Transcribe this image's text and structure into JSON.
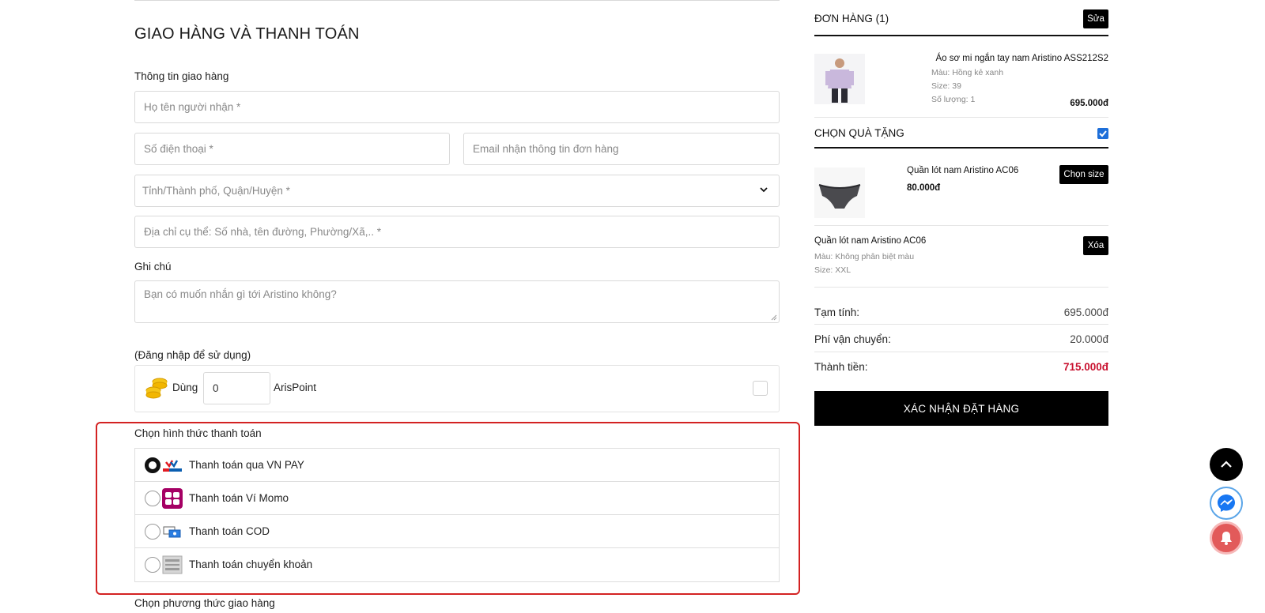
{
  "checkout": {
    "title": "GIAO HÀNG VÀ THANH TOÁN",
    "shipping_info_label": "Thông tin giao hàng",
    "fields": {
      "name_placeholder": "Họ tên người nhận *",
      "phone_placeholder": "Số điện thoại *",
      "email_placeholder": "Email nhận thông tin đơn hàng",
      "region_placeholder": "Tỉnh/Thành phố, Quận/Huyện *",
      "address_placeholder": "Địa chỉ cụ thể: Số nhà, tên đường, Phường/Xã,.. *"
    },
    "note_label": "Ghi chú",
    "note_placeholder": "Bạn có muốn nhắn gì tới Aristino không?",
    "login_hint": "(Đăng nhập để sử dụng)",
    "points": {
      "use_label": "Dùng",
      "value": "0",
      "unit": "ArisPoint"
    },
    "payment_label": "Chọn hình thức thanh toán",
    "payment_methods": [
      {
        "label": "Thanh toán qua VN PAY",
        "icon": "vnpay-icon",
        "selected": true
      },
      {
        "label": "Thanh toán Ví Momo",
        "icon": "momo-icon",
        "selected": false
      },
      {
        "label": "Thanh toán COD",
        "icon": "cod-icon",
        "selected": false
      },
      {
        "label": "Thanh toán chuyển khoản",
        "icon": "internet-banking-icon",
        "selected": false
      }
    ],
    "delivery_label": "Chọn phương thức giao hàng"
  },
  "order": {
    "title": "ĐƠN HÀNG (1)",
    "edit_label": "Sửa",
    "item": {
      "name": "Áo sơ mi ngắn tay nam Aristino ASS212S2",
      "color": "Màu: Hồng kẻ xanh",
      "size": "Size: 39",
      "qty": "Số lượng: 1",
      "price": "695.000đ"
    },
    "gift_title": "CHỌN QUÀ TẶNG",
    "gift_offer": {
      "name": "Quần lót nam Aristino AC06",
      "price": "80.000đ",
      "choose_size_label": "Chọn size"
    },
    "gift_selected": {
      "name": "Quần lót nam Aristino AC06",
      "color": "Màu: Không phân biệt màu",
      "size": "Size: XXL",
      "remove_label": "Xóa"
    },
    "subtotal_label": "Tạm tính:",
    "subtotal": "695.000đ",
    "shipping_label": "Phí vận chuyển:",
    "shipping": "20.000đ",
    "total_label": "Thành tiền:",
    "total": "715.000đ",
    "confirm_label": "XÁC NHẬN ĐẶT HÀNG"
  },
  "colors": {
    "accent_red": "#c8102e",
    "highlight_red": "#d32222",
    "black": "#000000"
  }
}
